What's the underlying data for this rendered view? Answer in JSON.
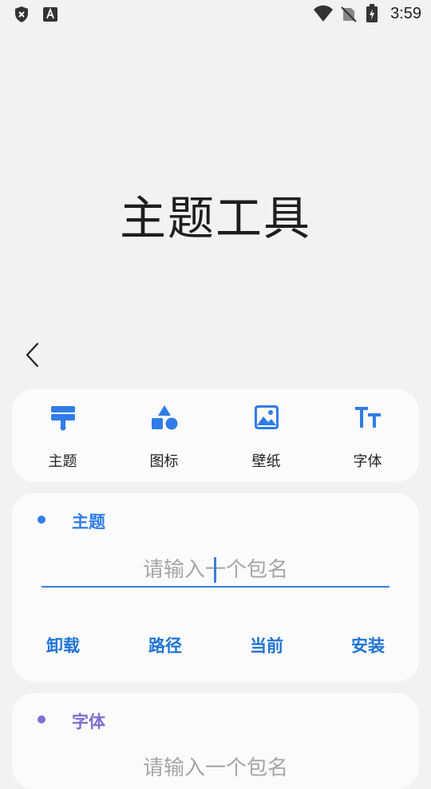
{
  "status_bar": {
    "time": "3:59",
    "icons": [
      "shield-x-icon",
      "font-a-icon",
      "wifi-icon",
      "no-sim-icon",
      "battery-charging-icon"
    ]
  },
  "page": {
    "title": "主题工具"
  },
  "nav": {
    "items": [
      {
        "label": "主题",
        "icon": "paint-brush-icon"
      },
      {
        "label": "图标",
        "icon": "shapes-icon"
      },
      {
        "label": "壁纸",
        "icon": "image-icon"
      },
      {
        "label": "字体",
        "icon": "text-size-icon"
      }
    ]
  },
  "sections": [
    {
      "title": "主题",
      "color": "#2f7ce8",
      "input_placeholder": "请输入一个包名",
      "actions": [
        "卸载",
        "路径",
        "当前",
        "安装"
      ]
    },
    {
      "title": "字体",
      "color": "#7b6fd2",
      "input_placeholder": "请输入一个包名"
    }
  ],
  "colors": {
    "accent": "#2f7ce8",
    "background": "#f2f2f2",
    "card": "#fbfbfb"
  }
}
